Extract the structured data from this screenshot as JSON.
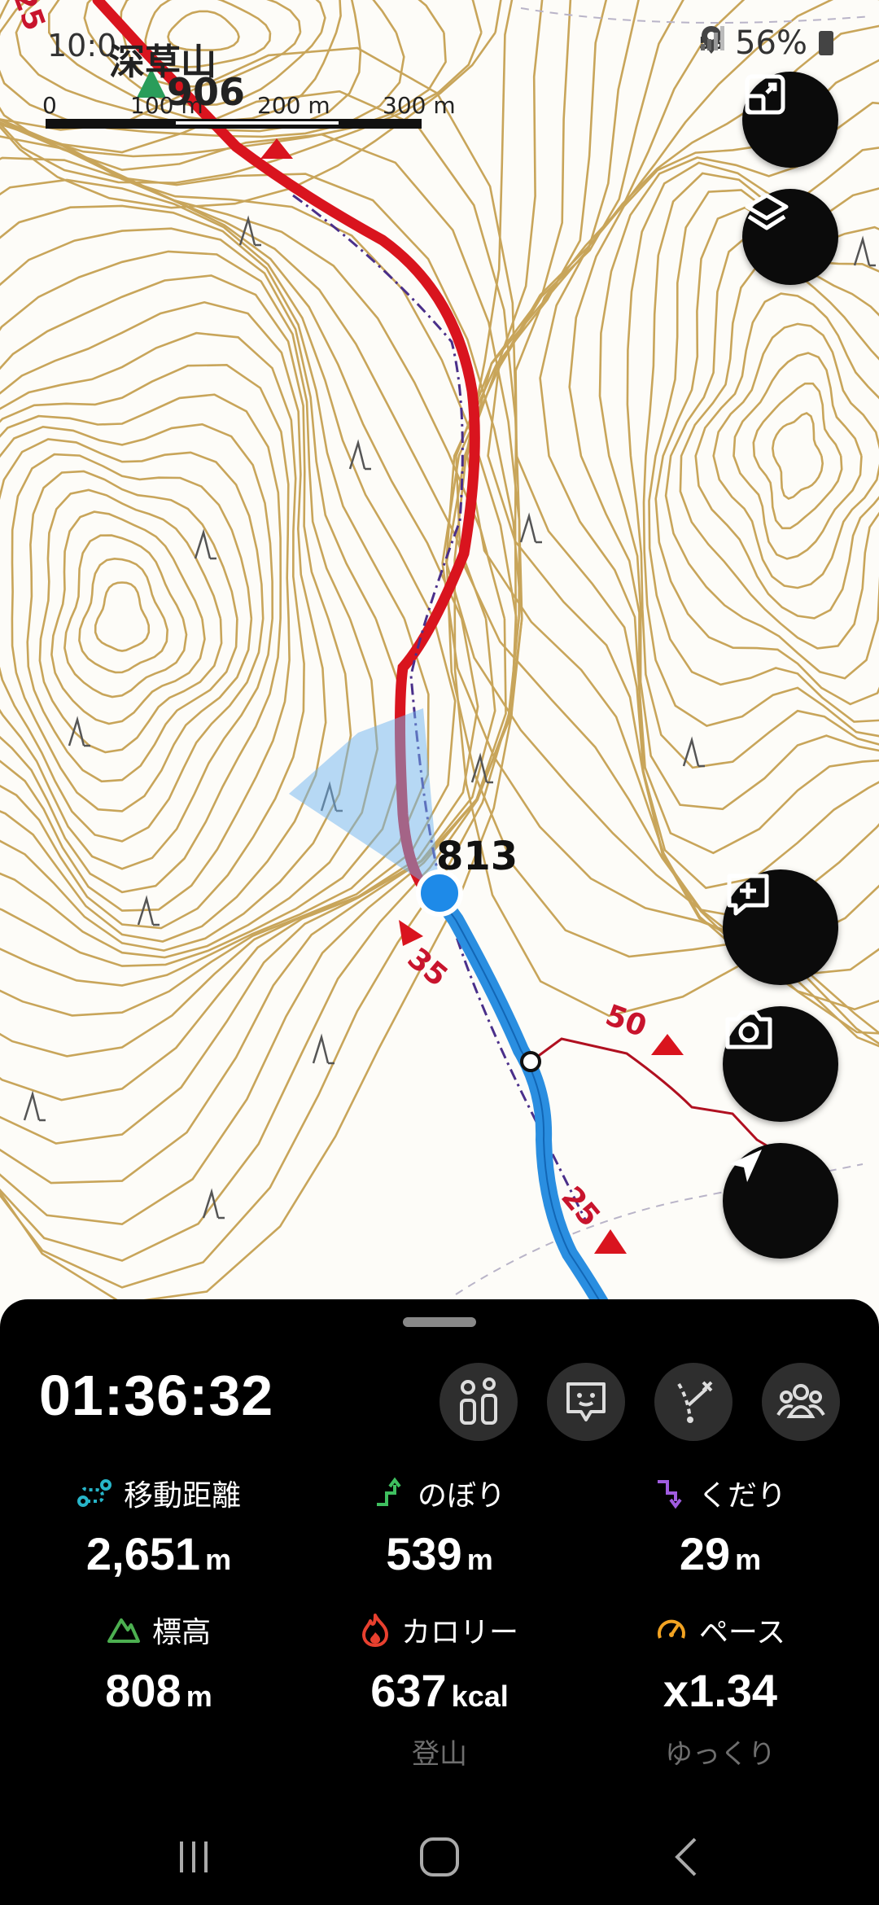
{
  "status_bar": {
    "time": "10:0",
    "network": "5G",
    "battery": "56%"
  },
  "map": {
    "peak_name": "深草山",
    "peak_elevation": "906",
    "scale_labels": [
      "0",
      "100 m",
      "200 m",
      "300 m"
    ],
    "current_elevation": "813",
    "trail_markers": [
      "25",
      "35",
      "50",
      "25"
    ],
    "buttons": {
      "fullscreen": "fullscreen-icon",
      "layers": "layers-icon",
      "add_note": "add-comment-icon",
      "camera": "camera-icon",
      "locate": "navigation-arrow-icon"
    },
    "colors": {
      "contour": "#c8a55a",
      "trail_red": "#d9141e",
      "track_blue": "#2a8ee0",
      "position": "#1e8ae8"
    }
  },
  "panel": {
    "elapsed_time": "01:36:32",
    "tools": [
      "route-icon",
      "guide-icon",
      "off-route-icon",
      "group-icon"
    ],
    "stats": {
      "distance": {
        "label": "移動距離",
        "value": "2,651",
        "unit": "m"
      },
      "ascent": {
        "label": "のぼり",
        "value": "539",
        "unit": "m"
      },
      "descent": {
        "label": "くだり",
        "value": "29",
        "unit": "m"
      },
      "elevation": {
        "label": "標高",
        "value": "808",
        "unit": "m"
      },
      "calories": {
        "label": "カロリー",
        "value": "637",
        "unit": "kcal",
        "sub": "登山"
      },
      "pace": {
        "label": "ペース",
        "value": "x1.34",
        "sub": "ゆっくり"
      }
    }
  },
  "system_nav": [
    "recent-apps-icon",
    "home-icon",
    "back-icon"
  ]
}
